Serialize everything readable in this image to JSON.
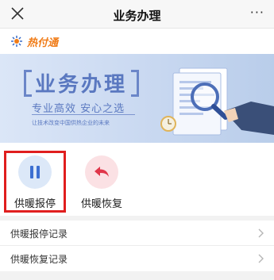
{
  "header": {
    "title": "业务办理",
    "more_label": "···",
    "close_icon": "close-icon",
    "background": "#f7f7f7"
  },
  "brand": {
    "logo_text": "热付通",
    "logo_icon": "sun-star-icon",
    "color": "#f07c18"
  },
  "banner": {
    "title": "业务办理",
    "subtitle": "专业高效  安心之选",
    "tagline": "让技术改变中国供热企业的未来",
    "accent": "#5a78c0"
  },
  "actions": [
    {
      "label": "供暖报停",
      "icon": "pause-icon",
      "color": "#3c6fd1",
      "highlighted": true
    },
    {
      "label": "供暖恢复",
      "icon": "undo-arrow-icon",
      "color": "#e0364a",
      "highlighted": false
    }
  ],
  "list": [
    {
      "label": "供暖报停记录",
      "icon": "chevron-right-icon"
    },
    {
      "label": "供暖恢复记录",
      "icon": "chevron-right-icon"
    }
  ],
  "colors": {
    "highlight_border": "#e01e1e",
    "page_background": "#f2f2f2"
  }
}
